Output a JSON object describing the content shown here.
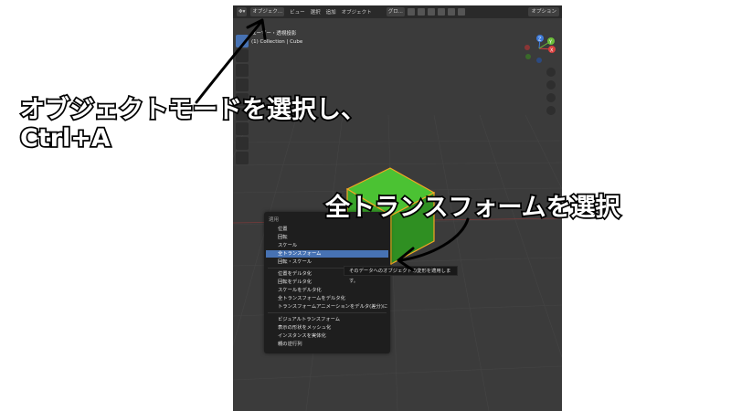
{
  "header": {
    "mode": "オブジェク...",
    "menu": [
      "ビュー",
      "選択",
      "追加",
      "オブジェクト"
    ],
    "global": "グロ...",
    "options": "オプション"
  },
  "info": {
    "view": "ユーザー・透視投影",
    "collection": "(1) Collection | Cube"
  },
  "menu": {
    "title": "適用",
    "items": [
      "位置",
      "回転",
      "スケール",
      "全トランスフォーム",
      "回転・スケール",
      "位置をデルタ化",
      "回転をデルタ化",
      "スケールをデルタ化",
      "全トランスフォームをデルタ化",
      "トランスフォームアニメーションをデルタ(差分)に",
      "ビジュアルトランスフォーム",
      "表示の形状をメッシュ化",
      "インスタンスを実体化",
      "親の逆行列"
    ],
    "highlighted_index": 3
  },
  "tooltip": "そのデータへのオブジェクトの変形を適用します。",
  "gizmo": {
    "x": "X",
    "y": "Y",
    "z": "Z"
  },
  "annotations": {
    "line1": "オブジェクトモードを選択し、",
    "line2": "Ctrl+A",
    "line3": "全トランスフォームを選択"
  },
  "colors": {
    "accent": "#4772b3",
    "cube_green": "#3aa52a",
    "cube_outline": "#f5a623",
    "viewport_bg": "#3b3b3b"
  }
}
